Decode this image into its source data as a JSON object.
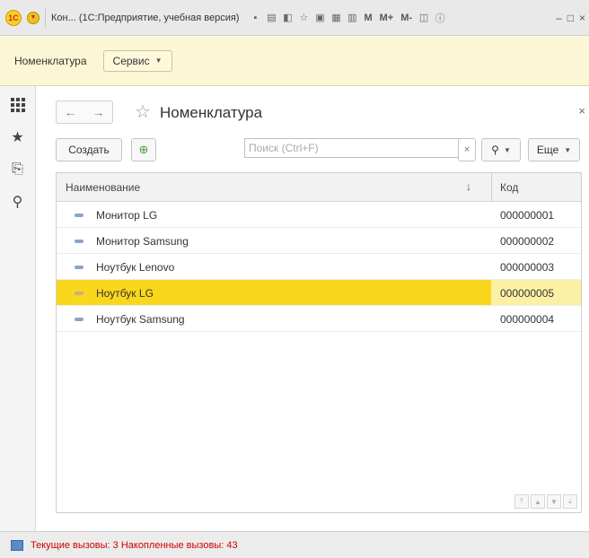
{
  "window": {
    "title": "Кон... (1С:Предприятие, учебная версия)",
    "logo": "1С",
    "m_buttons": [
      "M",
      "M+",
      "M-"
    ],
    "controls": [
      "–",
      "□",
      "×"
    ]
  },
  "sections": {
    "current": "Номенклатура",
    "service_button": "Сервис"
  },
  "form": {
    "title": "Номенклатура",
    "toolbar": {
      "create_label": "Создать",
      "search_placeholder": "Поиск (Ctrl+F)",
      "clear_label": "×",
      "more_label": "Еще"
    },
    "table": {
      "columns": [
        "Наименование",
        "Код"
      ],
      "sort_indicator": "↓",
      "rows": [
        {
          "name": "Монитор LG",
          "code": "000000001",
          "selected": false
        },
        {
          "name": "Монитор Samsung",
          "code": "000000002",
          "selected": false
        },
        {
          "name": "Ноутбук Lenovo",
          "code": "000000003",
          "selected": false
        },
        {
          "name": "Ноутбук LG",
          "code": "000000005",
          "selected": true
        },
        {
          "name": "Ноутбук Samsung",
          "code": "000000004",
          "selected": false
        }
      ]
    }
  },
  "status": {
    "text": "Текущие вызовы: 3   Накопленные вызовы: 43"
  },
  "colors": {
    "selection": "#f9d71c",
    "section_panel": "#fbf7d6",
    "status_text": "#d00000"
  }
}
